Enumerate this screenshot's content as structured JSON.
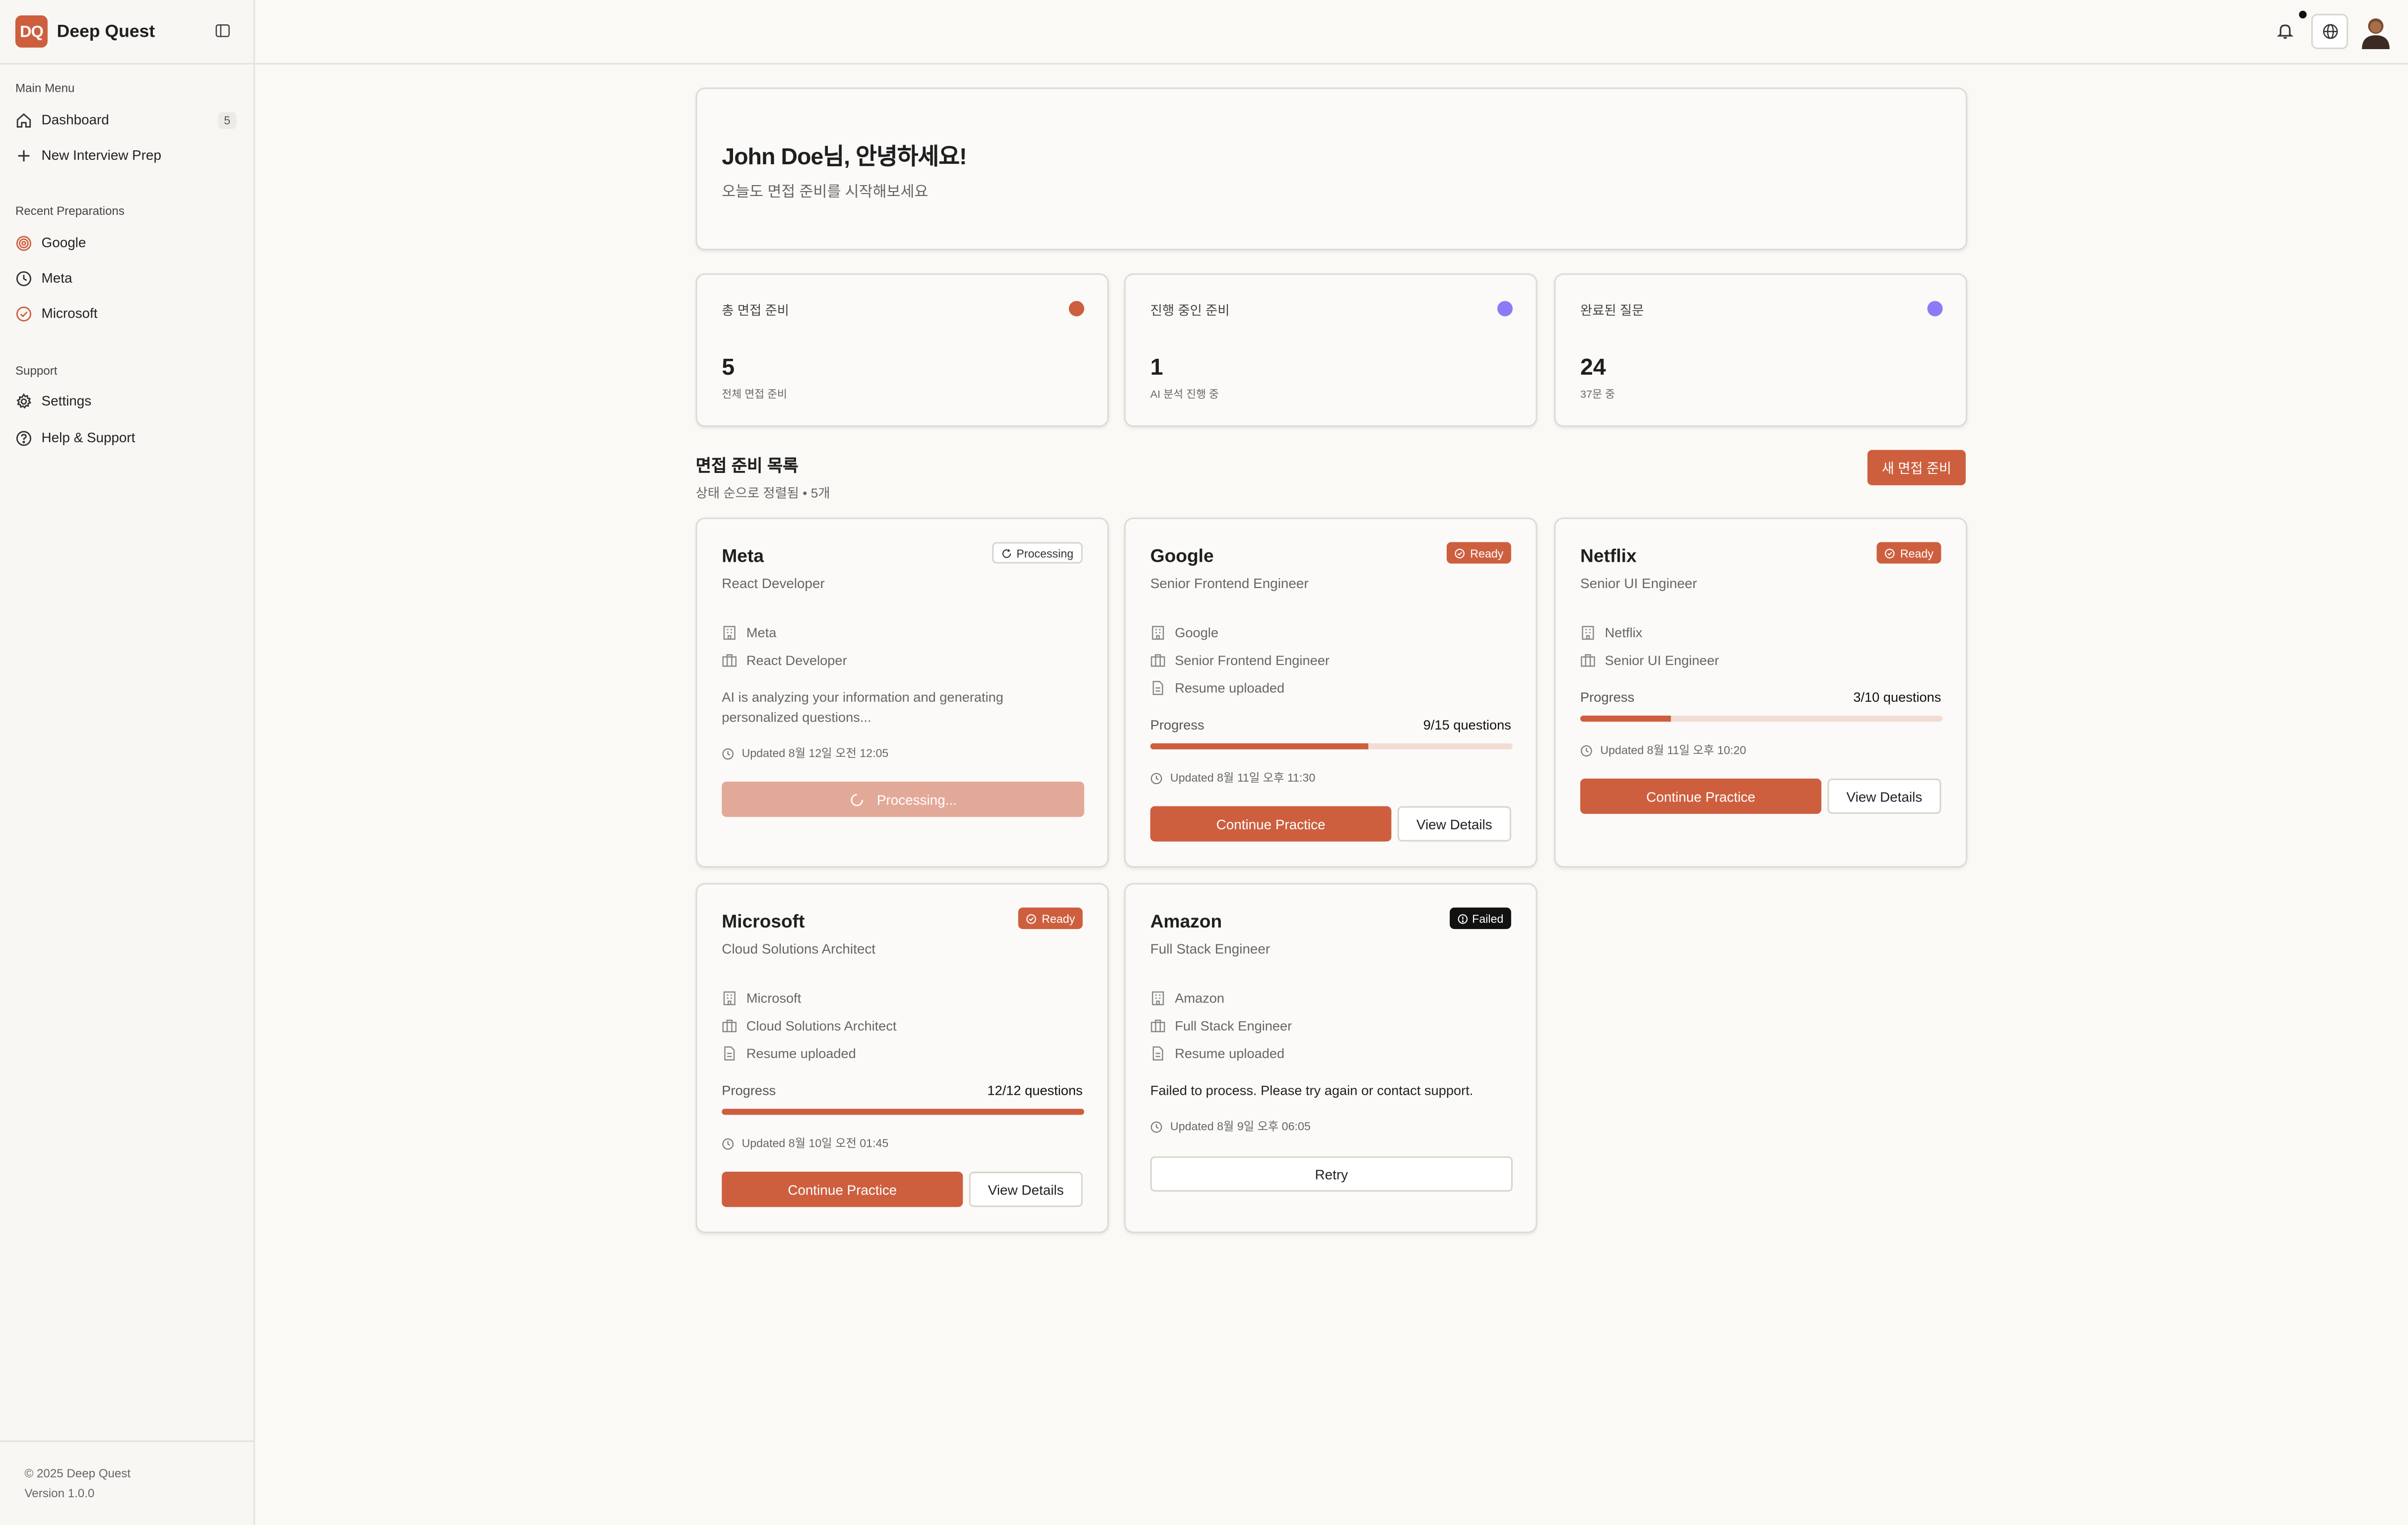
{
  "app": {
    "logo_text": "DQ",
    "name": "Deep Quest"
  },
  "sidebar": {
    "main_menu_title": "Main Menu",
    "dashboard_label": "Dashboard",
    "dashboard_count": "5",
    "new_prep_label": "New Interview Prep",
    "recent_title": "Recent Preparations",
    "recent": [
      "Google",
      "Meta",
      "Microsoft"
    ],
    "support_title": "Support",
    "settings_label": "Settings",
    "help_label": "Help & Support",
    "copyright": "© 2025 Deep Quest",
    "version": "Version 1.0.0"
  },
  "welcome": {
    "title": "John Doe님, 안녕하세요!",
    "subtitle": "오늘도 면접 준비를 시작해보세요"
  },
  "stats": [
    {
      "label": "총 면접 준비",
      "value": "5",
      "sub": "전체 면접 준비",
      "color": "#cd5f3f"
    },
    {
      "label": "진행 중인 준비",
      "value": "1",
      "sub": "AI 분석 진행 중",
      "color": "#8b7cf6"
    },
    {
      "label": "완료된 질문",
      "value": "24",
      "sub": "37문 중",
      "color": "#8b7cf6"
    }
  ],
  "list": {
    "title": "면접 준비 목록",
    "subtitle": "상태 순으로 정렬됨 • 5개",
    "new_button": "새 면접 준비"
  },
  "cards": [
    {
      "company": "Meta",
      "role": "React Developer",
      "status": "Processing",
      "info_company": "Meta",
      "info_role": "React Developer",
      "description": "AI is analyzing your information and generating personalized questions...",
      "updated": "Updated 8월 12일 오전 12:05",
      "button": "Processing..."
    },
    {
      "company": "Google",
      "role": "Senior Frontend Engineer",
      "status": "Ready",
      "info_company": "Google",
      "info_role": "Senior Frontend Engineer",
      "resume": "Resume uploaded",
      "progress_label": "Progress",
      "progress_count": "9/15 questions",
      "progress": 0.6,
      "updated": "Updated 8월 11일 오후 11:30",
      "primary": "Continue Practice",
      "secondary": "View Details"
    },
    {
      "company": "Netflix",
      "role": "Senior UI Engineer",
      "status": "Ready",
      "info_company": "Netflix",
      "info_role": "Senior UI Engineer",
      "progress_label": "Progress",
      "progress_count": "3/10 questions",
      "progress": 0.25,
      "updated": "Updated 8월 11일 오후 10:20",
      "primary": "Continue Practice",
      "secondary": "View Details"
    },
    {
      "company": "Microsoft",
      "role": "Cloud Solutions Architect",
      "status": "Ready",
      "info_company": "Microsoft",
      "info_role": "Cloud Solutions Architect",
      "resume": "Resume uploaded",
      "progress_label": "Progress",
      "progress_count": "12/12 questions",
      "progress": 1.0,
      "updated": "Updated 8월 10일 오전 01:45",
      "primary": "Continue Practice",
      "secondary": "View Details"
    },
    {
      "company": "Amazon",
      "role": "Full Stack Engineer",
      "status": "Failed",
      "info_company": "Amazon",
      "info_role": "Full Stack Engineer",
      "resume": "Resume uploaded",
      "error": "Failed to process. Please try again or contact support.",
      "updated": "Updated 8월 9일 오후 06:05",
      "button": "Retry"
    }
  ],
  "colors": {
    "accent": "#cd5f3f",
    "accent_light": "#f2ddd5",
    "purple": "#8b7cf6",
    "background": "#faf9f6"
  }
}
